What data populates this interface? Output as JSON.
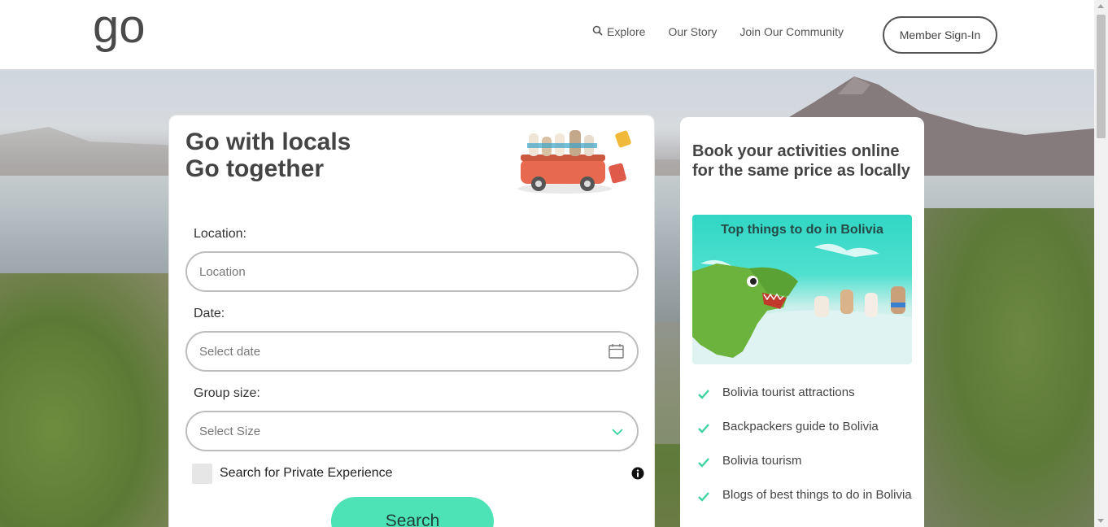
{
  "header": {
    "logo_text": "go",
    "nav": [
      {
        "label": "Explore",
        "icon": "search-icon"
      },
      {
        "label": "Our Story"
      },
      {
        "label": "Join Our Community"
      }
    ],
    "signin_label": "Member Sign-In"
  },
  "search_card": {
    "title_line1": "Go with locals",
    "title_line2": "Go together",
    "location": {
      "label": "Location:",
      "placeholder": "Location"
    },
    "date": {
      "label": "Date:",
      "placeholder": "Select date"
    },
    "group_size": {
      "label": "Group size:",
      "placeholder": "Select Size"
    },
    "private_label": "Search for Private Experience",
    "search_label": "Search"
  },
  "side_card": {
    "title": "Book your activities online for the same price as locally",
    "promo_title": "Top things to do in Bolivia",
    "links": [
      "Bolivia tourist attractions",
      "Backpackers guide to Bolivia",
      "Bolivia tourism",
      "Blogs of best things to do in Bolivia"
    ]
  },
  "colors": {
    "accent": "#4de3b6",
    "check": "#3ed3a3",
    "text_dark": "#444444",
    "border": "#bdbdbd"
  }
}
